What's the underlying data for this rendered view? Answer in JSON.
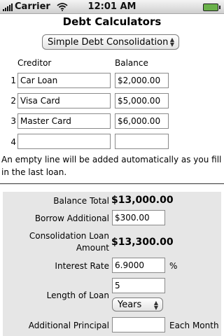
{
  "status_bar": {
    "carrier": "Carrier",
    "time": "12:01 AM"
  },
  "page": {
    "title": "Debt Calculators"
  },
  "calculator_select": {
    "selected": "Simple Debt Consolidation"
  },
  "table": {
    "creditor_header": "Creditor",
    "balance_header": "Balance",
    "rows": [
      {
        "num": "1",
        "creditor": "Car Loan",
        "balance": "$2,000.00"
      },
      {
        "num": "2",
        "creditor": "Visa Card",
        "balance": "$5,000.00"
      },
      {
        "num": "3",
        "creditor": "Master Card",
        "balance": "$6,000.00"
      },
      {
        "num": "4",
        "creditor": "",
        "balance": ""
      }
    ]
  },
  "note": "An empty line will be added automatically as you fill in the last loan.",
  "summary": {
    "balance_total_label": "Balance Total",
    "balance_total_value": "$13,000.00",
    "borrow_additional_label": "Borrow Additional",
    "borrow_additional_value": "$300.00",
    "consolidation_label_line1": "Consolidation Loan",
    "consolidation_label_line2": "Amount",
    "consolidation_value": "$13,300.00",
    "interest_rate_label": "Interest Rate",
    "interest_rate_value": "6.9000",
    "interest_rate_unit": "%",
    "length_label": "Length of Loan",
    "length_value": "5",
    "length_unit_selected": "Years",
    "additional_principal_label": "Additional Principal",
    "additional_principal_value": "",
    "additional_principal_unit": "Each Month"
  }
}
